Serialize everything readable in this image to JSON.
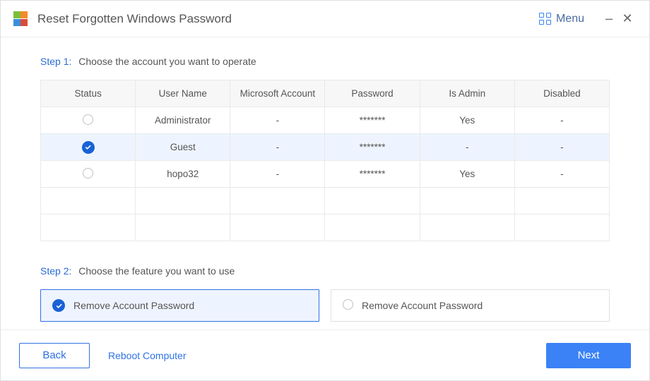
{
  "window": {
    "title": "Reset Forgotten Windows Password",
    "menu_label": "Menu"
  },
  "step1": {
    "label": "Step 1:",
    "desc": "Choose the account you want to operate"
  },
  "step2": {
    "label": "Step 2:",
    "desc": "Choose the feature you want to use"
  },
  "table": {
    "headers": [
      "Status",
      "User Name",
      "Microsoft Account",
      "Password",
      "Is Admin",
      "Disabled"
    ],
    "rows": [
      {
        "selected": false,
        "username": "Administrator",
        "ms": "-",
        "password": "*******",
        "admin": "Yes",
        "disabled": "-"
      },
      {
        "selected": true,
        "username": "Guest",
        "ms": "-",
        "password": "*******",
        "admin": "-",
        "disabled": "-"
      },
      {
        "selected": false,
        "username": "hopo32",
        "ms": "-",
        "password": "*******",
        "admin": "Yes",
        "disabled": "-"
      }
    ],
    "empty_rows": 2
  },
  "features": [
    {
      "selected": true,
      "label": "Remove Account Password"
    },
    {
      "selected": false,
      "label": "Remove Account Password"
    }
  ],
  "buttons": {
    "back": "Back",
    "reboot": "Reboot Computer",
    "next": "Next"
  }
}
